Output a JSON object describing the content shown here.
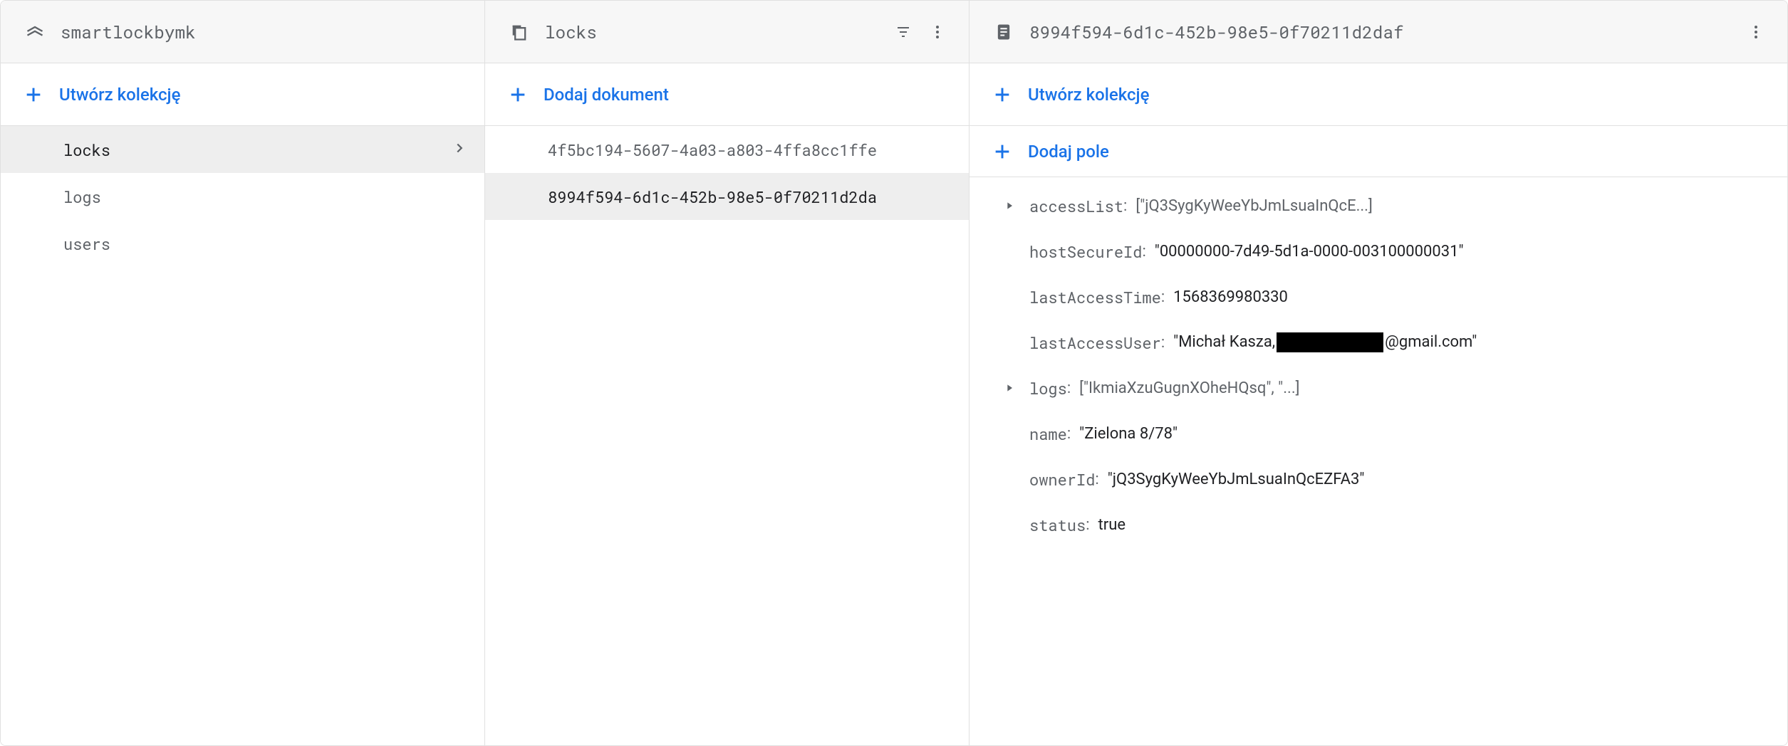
{
  "panel1": {
    "title": "smartlockbymk",
    "action": "Utwórz kolekcję",
    "collections": [
      {
        "name": "locks",
        "selected": true
      },
      {
        "name": "logs",
        "selected": false
      },
      {
        "name": "users",
        "selected": false
      }
    ]
  },
  "panel2": {
    "title": "locks",
    "action": "Dodaj dokument",
    "documents": [
      {
        "id": "4f5bc194-5607-4a03-a803-4ffa8cc1ffe",
        "selected": false
      },
      {
        "id": "8994f594-6d1c-452b-98e5-0f70211d2da",
        "selected": true
      }
    ]
  },
  "panel3": {
    "title": "8994f594-6d1c-452b-98e5-0f70211d2daf",
    "action_collection": "Utwórz kolekcję",
    "action_field": "Dodaj pole",
    "fields": {
      "accessList": {
        "key": "accessList",
        "value": "[\"jQ3SygKyWeeYbJmLsuaInQcE...]",
        "expandable": true
      },
      "hostSecureId": {
        "key": "hostSecureId",
        "value": "\"00000000-7d49-5d1a-0000-003100000031\""
      },
      "lastAccessTime": {
        "key": "lastAccessTime",
        "value": "1568369980330"
      },
      "lastAccessUser": {
        "key": "lastAccessUser",
        "value_pre": "\"Michał Kasza,",
        "value_post": "@gmail.com\"",
        "redacted": true
      },
      "logs": {
        "key": "logs",
        "value": "[\"IkmiaXzuGugnXOheHQsq\", \"...]",
        "expandable": true
      },
      "name": {
        "key": "name",
        "value": "\"Zielona 8/78\""
      },
      "ownerId": {
        "key": "ownerId",
        "value": "\"jQ3SygKyWeeYbJmLsuaInQcEZFA3\""
      },
      "status": {
        "key": "status",
        "value": "true"
      }
    }
  }
}
